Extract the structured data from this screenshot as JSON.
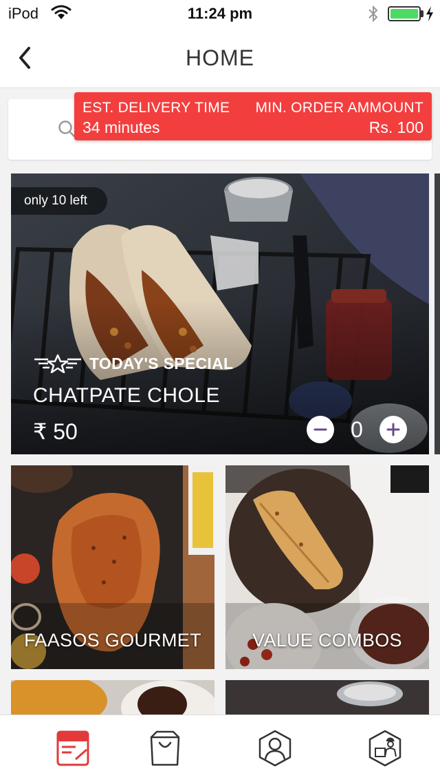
{
  "status_bar": {
    "carrier": "iPod",
    "time": "11:24 pm",
    "battery_color": "#4cd964"
  },
  "nav": {
    "title": "HOME",
    "back_icon": "chevron-left-icon"
  },
  "search": {
    "icon": "search-icon"
  },
  "delivery": {
    "time_label": "EST. DELIVERY TIME",
    "time_value": "34 minutes",
    "min_order_label": "MIN. ORDER AMMOUNT",
    "min_order_value": "Rs. 100",
    "accent_color": "#f33e3e"
  },
  "special": {
    "badge": "only 10 left",
    "tag": "TODAY'S SPECIAL",
    "dish": "CHATPATE CHOLE",
    "price": "₹ 50",
    "quantity": "0"
  },
  "categories": [
    {
      "label": "FAASOS GOURMET"
    },
    {
      "label": "VALUE COMBOS"
    }
  ],
  "tabs": [
    {
      "icon": "menu-card-icon",
      "active": true,
      "color": "#e23a3a"
    },
    {
      "icon": "shopping-bag-icon",
      "active": false
    },
    {
      "icon": "profile-icon",
      "active": false
    },
    {
      "icon": "delivery-person-icon",
      "active": false
    }
  ]
}
